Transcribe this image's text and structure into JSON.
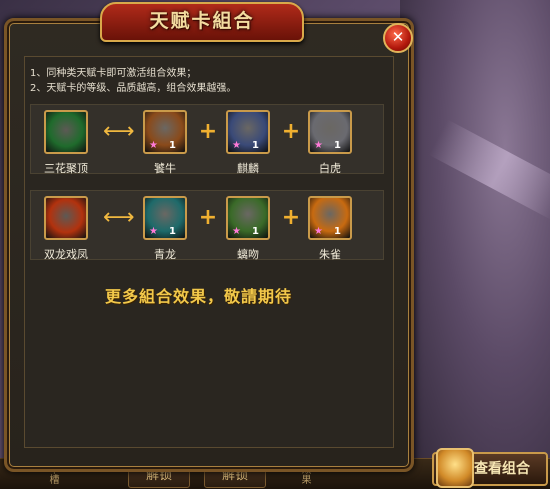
{
  "dialog": {
    "title": "天赋卡組合",
    "close_symbol": "✕",
    "rules": [
      "1、同种类天赋卡即可激活组合效果；",
      "2、天赋卡的等级、品质越高，组合效果越强。"
    ],
    "combos": [
      {
        "result": {
          "name": "三花聚顶",
          "icon": "green-rune-icon",
          "color": "#1f6b2c"
        },
        "cards": [
          {
            "name": "饕牛",
            "icon": "bull-beast-icon",
            "color": "#8a4a1a",
            "level": "1"
          },
          {
            "name": "麒麟",
            "icon": "qilin-icon",
            "color": "#3a4a78",
            "level": "1"
          },
          {
            "name": "白虎",
            "icon": "white-tiger-icon",
            "color": "#6a6a70",
            "level": "1"
          }
        ]
      },
      {
        "result": {
          "name": "双龙戏凤",
          "icon": "flame-blade-icon",
          "color": "#b2320e"
        },
        "cards": [
          {
            "name": "青龙",
            "icon": "azure-dragon-icon",
            "color": "#1e6a6a",
            "level": "1"
          },
          {
            "name": "螭吻",
            "icon": "chiwen-icon",
            "color": "#3a6a28",
            "level": "1"
          },
          {
            "name": "朱雀",
            "icon": "vermilion-bird-icon",
            "color": "#c86a10",
            "level": "1"
          }
        ]
      }
    ],
    "more_text": "更多組合效果，敬請期待",
    "star_symbol": "★",
    "arrow_symbol": "⟷",
    "plus_symbol": "+"
  },
  "bottom_bar": {
    "unlock_1": "解锁",
    "unlock_2": "解锁",
    "slot_label": "卡槽",
    "effect_label": "效果"
  },
  "view_combo_button": {
    "label": "查看组合"
  },
  "colors": {
    "accent_gold": "#c99a4a",
    "title_red": "#b02a1a",
    "highlight_text": "#f2c84a"
  }
}
